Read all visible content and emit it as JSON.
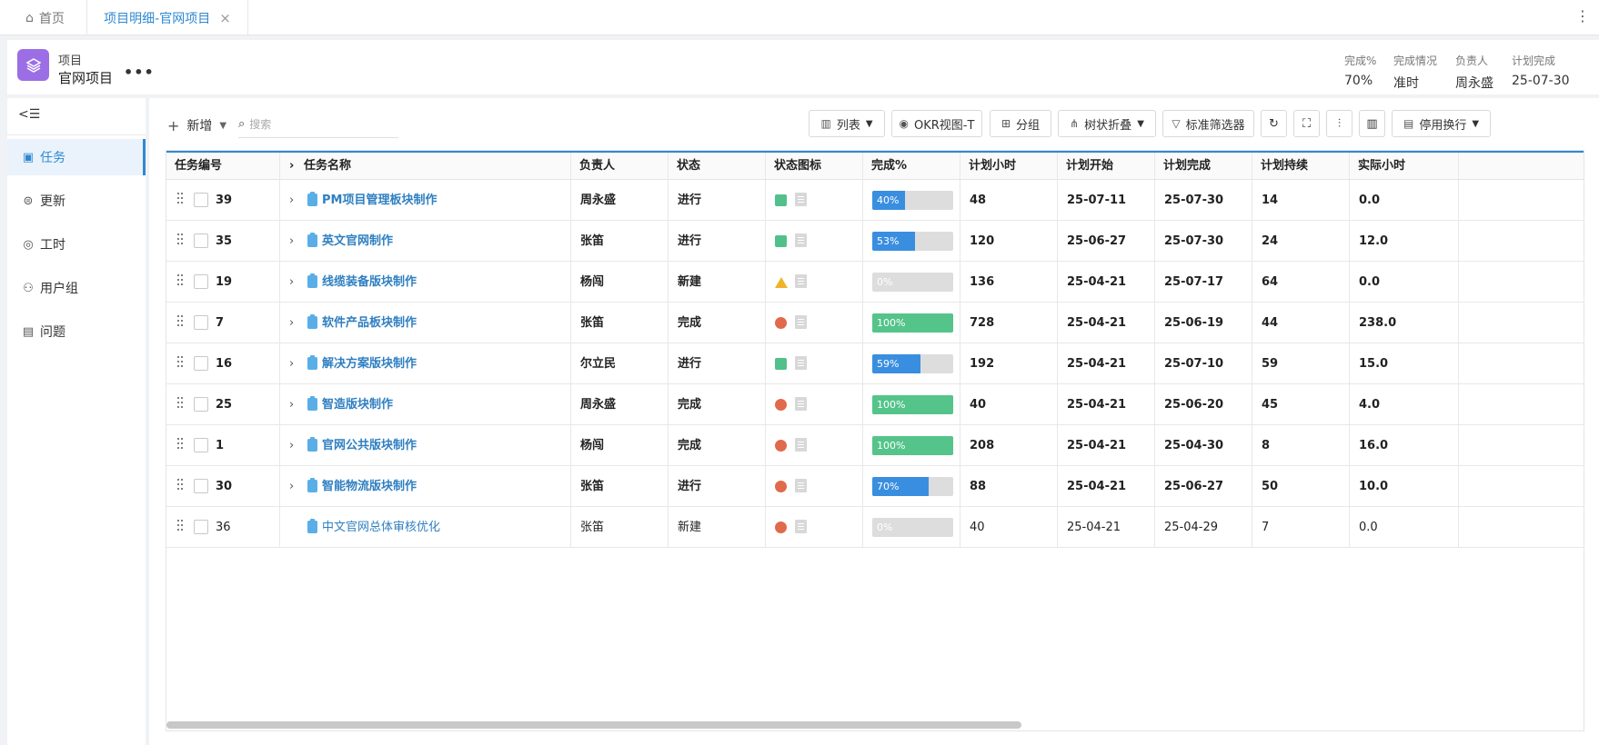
{
  "tabs": {
    "home_label": "首页",
    "active_label": "项目明细-官网项目",
    "close_glyph": "×",
    "menu_glyph": "⋮"
  },
  "project": {
    "type": "项目",
    "name": "官网项目",
    "more": "•••",
    "stats": [
      {
        "label": "完成%",
        "value": "70%"
      },
      {
        "label": "完成情况",
        "value": "准时"
      },
      {
        "label": "负责人",
        "value": "周永盛"
      },
      {
        "label": "计划完成",
        "value": "25-07-30"
      }
    ]
  },
  "sidebar": {
    "collapse_glyph": "<☰",
    "items": [
      {
        "label": "任务",
        "icon": "task-icon",
        "active": true
      },
      {
        "label": "更新",
        "icon": "update-icon",
        "active": false
      },
      {
        "label": "工时",
        "icon": "timer-icon",
        "active": false
      },
      {
        "label": "用户组",
        "icon": "users-icon",
        "active": false
      },
      {
        "label": "问题",
        "icon": "issue-icon",
        "active": false
      }
    ]
  },
  "toolbar": {
    "add_label": "新增",
    "search_placeholder": "搜索",
    "list_label": "列表",
    "okr_label": "OKR视图-T",
    "group_label": "分组",
    "tree_label": "树状折叠",
    "filter_label": "标准筛选器",
    "wrap_label": "停用换行"
  },
  "table": {
    "headers": [
      "任务编号",
      "任务名称",
      "负责人",
      "状态",
      "状态图标",
      "完成%",
      "计划小时",
      "计划开始",
      "计划完成",
      "计划持续",
      "实际小时"
    ],
    "rows": [
      {
        "id": "39",
        "name": "PM项目管理板块制作",
        "owner": "周永盛",
        "status": "进行",
        "icon": "green",
        "pct": "40%",
        "pct_num": 40,
        "hours": "48",
        "start": "25-07-11",
        "end": "25-07-30",
        "dur": "14",
        "actual": "0.0",
        "bold": true,
        "expandable": true
      },
      {
        "id": "35",
        "name": "英文官网制作",
        "owner": "张笛",
        "status": "进行",
        "icon": "green",
        "pct": "53%",
        "pct_num": 53,
        "hours": "120",
        "start": "25-06-27",
        "end": "25-07-30",
        "dur": "24",
        "actual": "12.0",
        "bold": true,
        "expandable": true
      },
      {
        "id": "19",
        "name": "线缆装备版块制作",
        "owner": "杨闯",
        "status": "新建",
        "icon": "warn",
        "pct": "0%",
        "pct_num": 0,
        "hours": "136",
        "start": "25-04-21",
        "end": "25-07-17",
        "dur": "64",
        "actual": "0.0",
        "bold": true,
        "expandable": true
      },
      {
        "id": "7",
        "name": "软件产品板块制作",
        "owner": "张笛",
        "status": "完成",
        "icon": "red",
        "pct": "100%",
        "pct_num": 100,
        "hours": "728",
        "start": "25-04-21",
        "end": "25-06-19",
        "dur": "44",
        "actual": "238.0",
        "bold": true,
        "expandable": true
      },
      {
        "id": "16",
        "name": "解决方案版块制作",
        "owner": "尔立民",
        "status": "进行",
        "icon": "green",
        "pct": "59%",
        "pct_num": 59,
        "hours": "192",
        "start": "25-04-21",
        "end": "25-07-10",
        "dur": "59",
        "actual": "15.0",
        "bold": true,
        "expandable": true
      },
      {
        "id": "25",
        "name": "智造版块制作",
        "owner": "周永盛",
        "status": "完成",
        "icon": "red",
        "pct": "100%",
        "pct_num": 100,
        "hours": "40",
        "start": "25-04-21",
        "end": "25-06-20",
        "dur": "45",
        "actual": "4.0",
        "bold": true,
        "expandable": true
      },
      {
        "id": "1",
        "name": "官网公共版块制作",
        "owner": "杨闯",
        "status": "完成",
        "icon": "red",
        "pct": "100%",
        "pct_num": 100,
        "hours": "208",
        "start": "25-04-21",
        "end": "25-04-30",
        "dur": "8",
        "actual": "16.0",
        "bold": true,
        "expandable": true
      },
      {
        "id": "30",
        "name": "智能物流版块制作",
        "owner": "张笛",
        "status": "进行",
        "icon": "red",
        "pct": "70%",
        "pct_num": 70,
        "hours": "88",
        "start": "25-04-21",
        "end": "25-06-27",
        "dur": "50",
        "actual": "10.0",
        "bold": true,
        "expandable": true
      },
      {
        "id": "36",
        "name": "中文官网总体审核优化",
        "owner": "张笛",
        "status": "新建",
        "icon": "red",
        "pct": "0%",
        "pct_num": 0,
        "hours": "40",
        "start": "25-04-21",
        "end": "25-04-29",
        "dur": "7",
        "actual": "0.0",
        "bold": false,
        "expandable": false
      }
    ]
  },
  "colors": {
    "accent": "#2f88d1",
    "progress_blue": "#3a8ee0",
    "progress_green": "#55c48a",
    "project_icon": "#9b6ee6"
  }
}
